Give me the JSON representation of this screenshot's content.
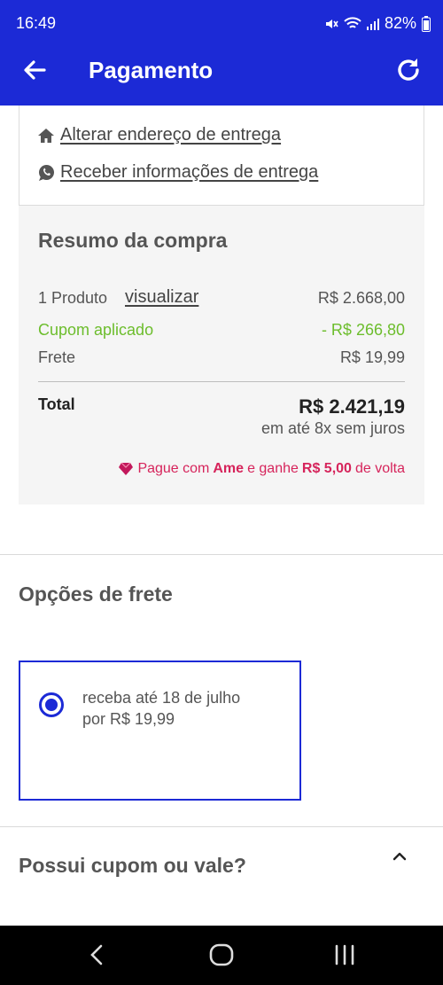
{
  "status_bar": {
    "time": "16:49",
    "battery": "82%",
    "icons": [
      "mute-icon",
      "wifi-icon",
      "signal-icon",
      "battery-icon"
    ]
  },
  "app_bar": {
    "title": "Pagamento",
    "back_icon": "arrow-left-icon",
    "refresh_icon": "refresh-icon"
  },
  "address": {
    "change_address": "Alterar endereço de entrega",
    "receive_info": "Receber informações de entrega"
  },
  "summary": {
    "title": "Resumo da compra",
    "product_label": "1 Produto",
    "view_link": "visualizar",
    "product_value": "R$ 2.668,00",
    "coupon_label": "Cupom aplicado",
    "coupon_value": "- R$ 266,80",
    "shipping_label": "Frete",
    "shipping_value": "R$ 19,99",
    "total_label": "Total",
    "total_value": "R$ 2.421,19",
    "installments": "em até 8x sem juros",
    "ame_prefix": "Pague com",
    "ame_brand": "Ame",
    "ame_middle": "e ganhe",
    "ame_amount": "R$ 5,00",
    "ame_suffix": "de volta"
  },
  "shipping_options": {
    "title": "Opções de frete",
    "option_line1": "receba até 18 de julho",
    "option_line2": "por R$ 19,99"
  },
  "coupon_section": {
    "title": "Possui cupom ou vale?"
  },
  "colors": {
    "primary": "#1c2ad6",
    "coupon_green": "#6cbd2c",
    "ame_pink": "#d6245b"
  }
}
